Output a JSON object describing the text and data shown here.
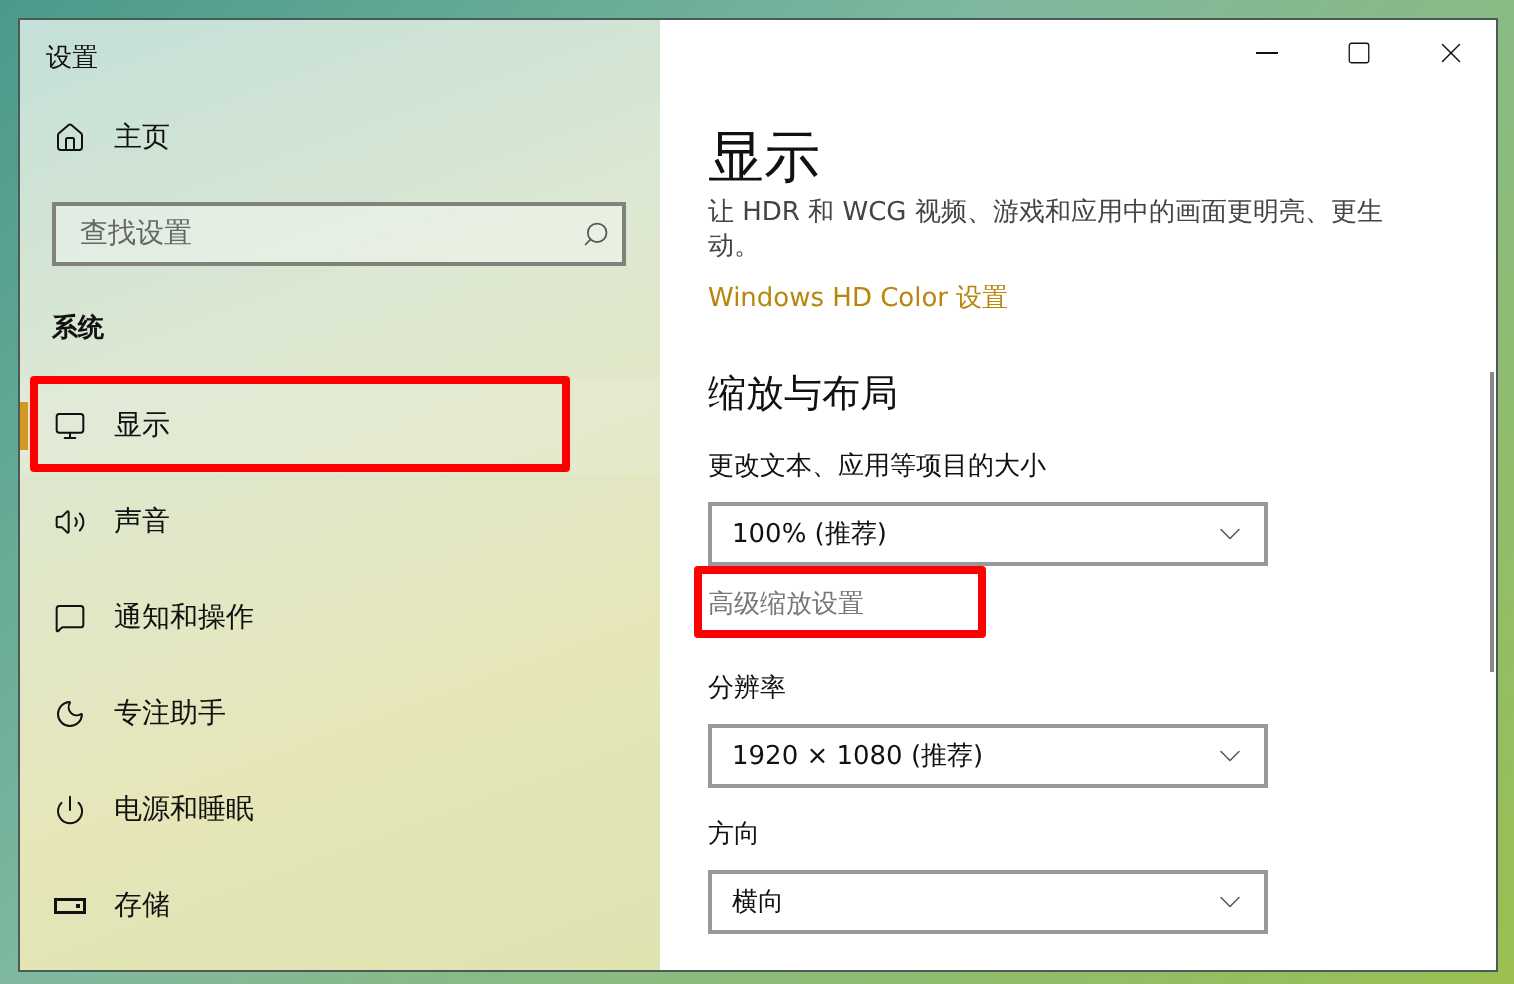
{
  "window": {
    "title": "设置"
  },
  "sidebar": {
    "home": "主页",
    "search": {
      "placeholder": "查找设置"
    },
    "section": "系统",
    "items": [
      {
        "kind": "display",
        "label": "显示",
        "selected": true,
        "annotated": true
      },
      {
        "kind": "sound",
        "label": "声音",
        "selected": false,
        "annotated": false
      },
      {
        "kind": "notifications",
        "label": "通知和操作",
        "selected": false,
        "annotated": false
      },
      {
        "kind": "focus",
        "label": "专注助手",
        "selected": false,
        "annotated": false
      },
      {
        "kind": "power",
        "label": "电源和睡眠",
        "selected": false,
        "annotated": false
      },
      {
        "kind": "storage",
        "label": "存储",
        "selected": false,
        "annotated": false
      }
    ]
  },
  "content": {
    "title": "显示",
    "description": "让 HDR 和 WCG 视频、游戏和应用中的画面更明亮、更生动。",
    "hd_link": "Windows HD Color 设置",
    "section": "缩放与布局",
    "settings": [
      {
        "kind": "dropdown",
        "label": "更改文本、应用等项目的大小",
        "value": "100% (推荐)"
      },
      {
        "kind": "link",
        "label": "高级缩放设置",
        "annotated": true
      },
      {
        "kind": "dropdown",
        "label": "分辨率",
        "value": "1920 × 1080 (推荐)"
      },
      {
        "kind": "dropdown",
        "label": "方向",
        "value": "横向"
      }
    ]
  }
}
